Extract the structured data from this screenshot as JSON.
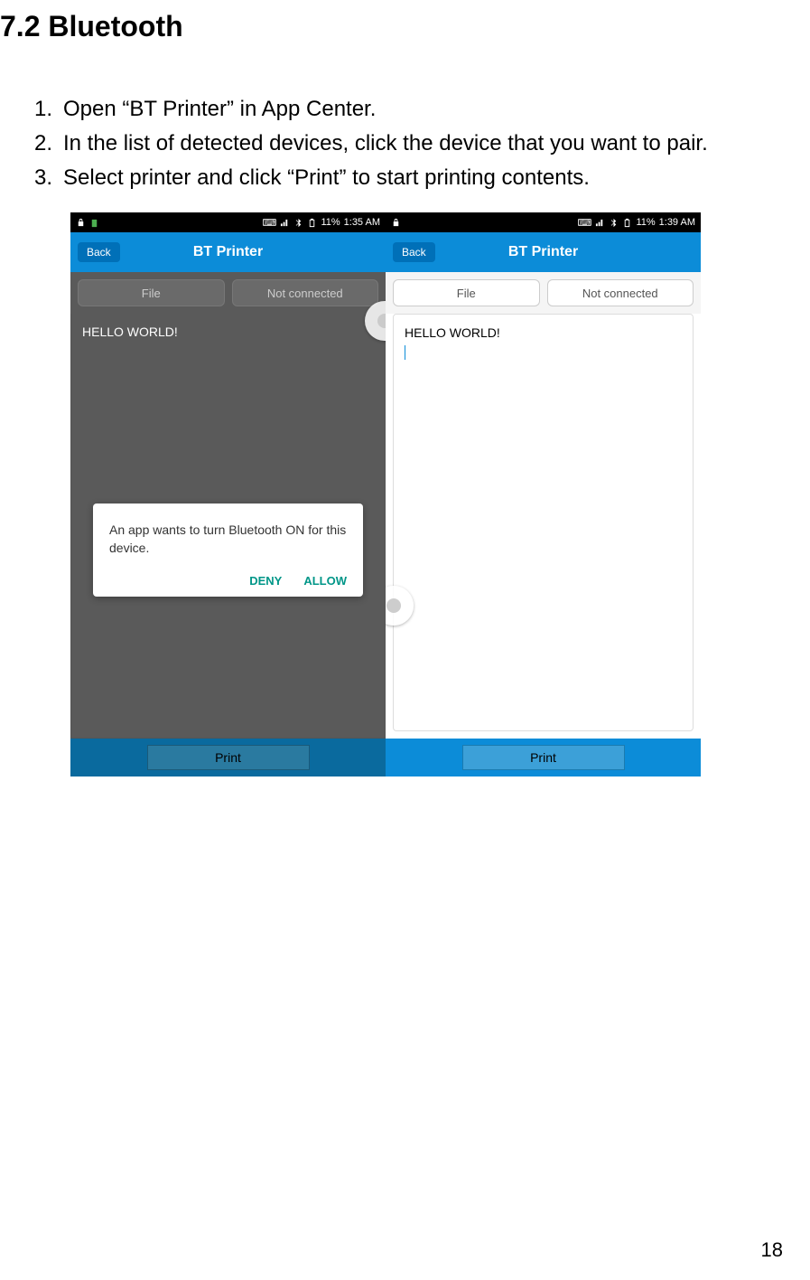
{
  "section": {
    "title": "7.2 Bluetooth"
  },
  "steps": [
    {
      "num": "1.",
      "text": "Open “BT Printer” in App Center."
    },
    {
      "num": "2.",
      "text": "In the list of detected devices, click the device that you want to pair."
    },
    {
      "num": "3.",
      "text": "Select printer and click “Print” to start printing contents."
    }
  ],
  "phone1": {
    "status": {
      "battery": "11%",
      "time": "1:35 AM"
    },
    "appTitle": "BT Printer",
    "back": "Back",
    "fileBtn": "File",
    "connBtn": "Not connected",
    "content": "HELLO WORLD!",
    "print": "Print",
    "dialog": {
      "text": "An app wants to turn Bluetooth ON for this device.",
      "deny": "DENY",
      "allow": "ALLOW"
    }
  },
  "phone2": {
    "status": {
      "battery": "11%",
      "time": "1:39 AM"
    },
    "appTitle": "BT Printer",
    "back": "Back",
    "fileBtn": "File",
    "connBtn": "Not connected",
    "content": "HELLO WORLD!",
    "print": "Print"
  },
  "pageNumber": "18"
}
